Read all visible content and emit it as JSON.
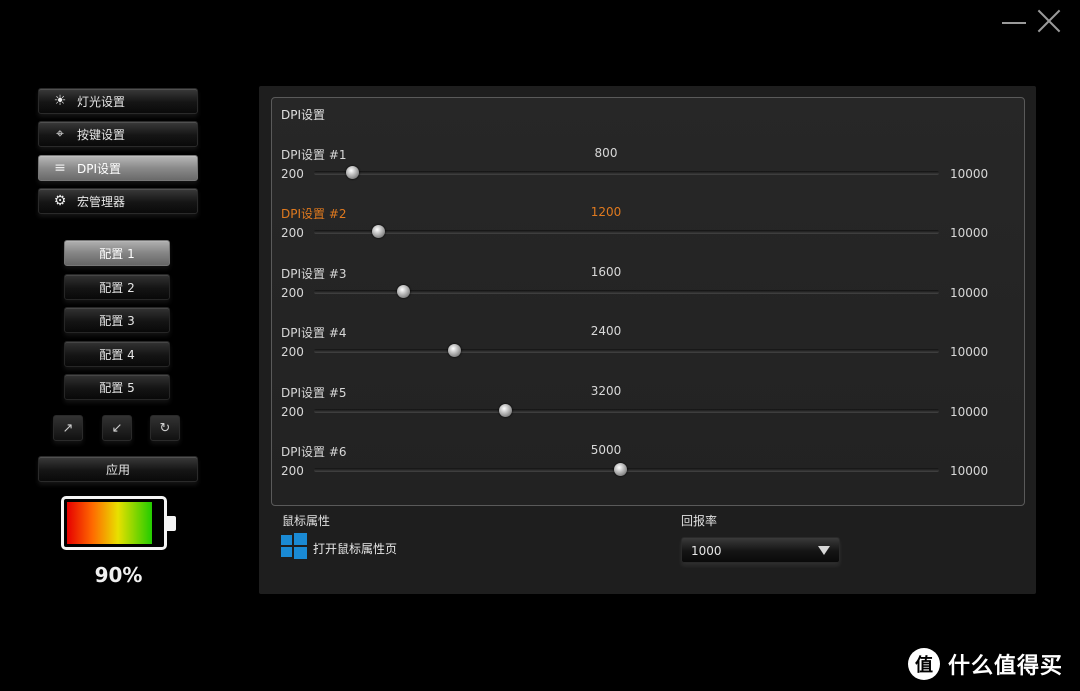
{
  "nav": {
    "items": [
      {
        "label": "灯光设置",
        "icon": "sun-icon",
        "glyph": "☀",
        "active": false
      },
      {
        "label": "按键设置",
        "icon": "crosshair-icon",
        "glyph": "⌖",
        "active": false
      },
      {
        "label": "DPI设置",
        "icon": "sliders-icon",
        "glyph": "≡",
        "active": true
      },
      {
        "label": "宏管理器",
        "icon": "gear-icon",
        "glyph": "⚙",
        "active": false
      }
    ]
  },
  "profiles": {
    "items": [
      {
        "label": "配置 1",
        "active": true
      },
      {
        "label": "配置 2",
        "active": false
      },
      {
        "label": "配置 3",
        "active": false
      },
      {
        "label": "配置 4",
        "active": false
      },
      {
        "label": "配置 5",
        "active": false
      }
    ]
  },
  "tools": {
    "import_glyph": "↗",
    "export_glyph": "↙",
    "reset_glyph": "↻"
  },
  "apply_label": "应用",
  "battery": {
    "percent_label": "90%",
    "level": 0.9
  },
  "dpi": {
    "title": "DPI设置",
    "min": 200,
    "max": 10000,
    "min_label": "200",
    "max_label": "10000",
    "rows": [
      {
        "label": "DPI设置 #1",
        "value": 800,
        "value_label": "800",
        "selected": false
      },
      {
        "label": "DPI设置 #2",
        "value": 1200,
        "value_label": "1200",
        "selected": true
      },
      {
        "label": "DPI设置 #3",
        "value": 1600,
        "value_label": "1600",
        "selected": false
      },
      {
        "label": "DPI设置 #4",
        "value": 2400,
        "value_label": "2400",
        "selected": false
      },
      {
        "label": "DPI设置 #5",
        "value": 3200,
        "value_label": "3200",
        "selected": false
      },
      {
        "label": "DPI设置 #6",
        "value": 5000,
        "value_label": "5000",
        "selected": false
      }
    ],
    "selected_color": "#e07a1f"
  },
  "mouse_properties": {
    "title": "鼠标属性",
    "open_label": "打开鼠标属性页",
    "icon": "windows-logo-icon",
    "icon_color": "#1a8ad4"
  },
  "report_rate": {
    "title": "回报率",
    "value": "1000"
  },
  "watermark": {
    "logo_glyph": "值",
    "text": "什么值得买"
  }
}
